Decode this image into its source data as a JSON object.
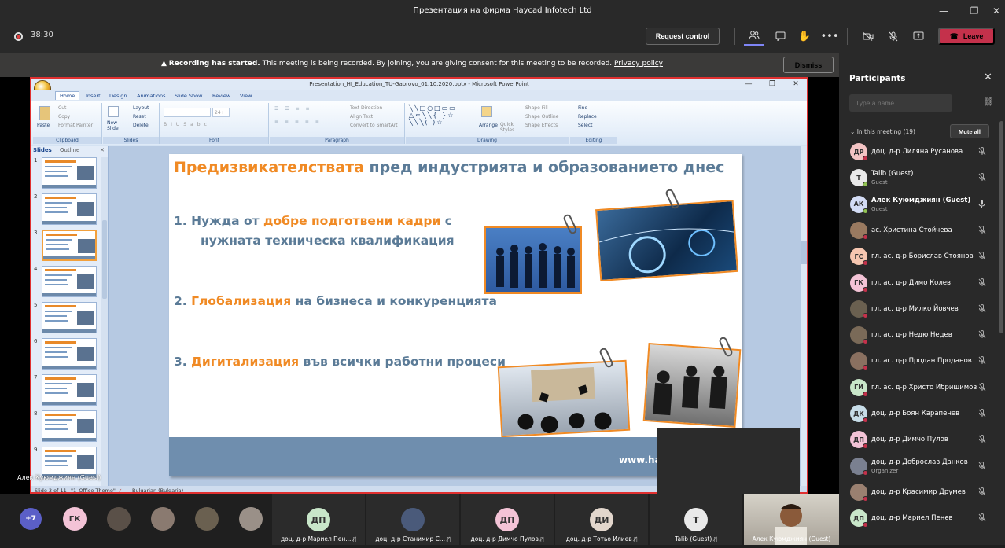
{
  "window": {
    "title": "Презентация на фирма Haycad Infotech Ltd"
  },
  "toolbar": {
    "timer": "38:30",
    "request_control": "Request control",
    "leave": "Leave"
  },
  "banner": {
    "strong": "Recording has started.",
    "message": "This meeting is being recorded. By joining, you are giving consent for this meeting to be recorded.",
    "link": "Privacy policy",
    "dismiss": "Dismiss"
  },
  "ppt": {
    "title": "Presentation_HI_Education_TU-Gabrovo_01.10.2020.pptx - Microsoft PowerPoint",
    "tabs": [
      "Home",
      "Insert",
      "Design",
      "Animations",
      "Slide Show",
      "Review",
      "View"
    ],
    "ribbon": {
      "clipboard": {
        "paste": "Paste",
        "cut": "Cut",
        "copy": "Copy",
        "format_painter": "Format Painter",
        "label": "Clipboard"
      },
      "slides": {
        "new_slide": "New Slide",
        "layout": "Layout",
        "reset": "Reset",
        "delete": "Delete",
        "label": "Slides"
      },
      "font": {
        "size": "24+",
        "label": "Font"
      },
      "paragraph": {
        "text_direction": "Text Direction",
        "align_text": "Align Text",
        "smartart": "Convert to SmartArt",
        "label": "Paragraph"
      },
      "drawing": {
        "arrange": "Arrange",
        "quick_styles": "Quick Styles",
        "shape_fill": "Shape Fill",
        "shape_outline": "Shape Outline",
        "shape_effects": "Shape Effects",
        "label": "Drawing"
      },
      "editing": {
        "find": "Find",
        "replace": "Replace",
        "select": "Select",
        "label": "Editing"
      }
    },
    "pane_tabs": {
      "slides": "Slides",
      "outline": "Outline"
    },
    "thumb_numbers": [
      "1",
      "2",
      "3",
      "4",
      "5",
      "6",
      "7",
      "8",
      "9"
    ],
    "status": {
      "slide": "Slide 3 of 11",
      "theme": "\"1_Office Theme\"",
      "lang": "Bulgarian (Bulgaria)"
    }
  },
  "slide": {
    "title_hl": "Предизвикателствата",
    "title_rest": " пред индустрията и образованието днес",
    "item1_a": "1.   Нужда от ",
    "item1_hl": "добре подготвени кадри",
    "item1_b": " с",
    "item1_line2": "нужната техническа квалификация",
    "item2_a": "2. ",
    "item2_hl": "Глобализация",
    "item2_b": " на бизнеса и конкуренцията",
    "item3_a": "3. ",
    "item3_hl": "Дигитализация",
    "item3_b": " във всички работни процеси",
    "url": "www.hay"
  },
  "presenter_label": "Алек Куюмджиян (Guest)",
  "bottom": {
    "more": "+7",
    "gk": "ГК",
    "tiles": [
      {
        "initials": "ДП",
        "name": "доц. д-р Мариел Пен..."
      },
      {
        "initials": "",
        "name": "доц. д-р Станимир С..."
      },
      {
        "initials": "ДП",
        "name": "доц. д-р Димчо Пулов"
      },
      {
        "initials": "ДИ",
        "name": "доц. д-р Тотьо Илиев"
      },
      {
        "initials": "Т",
        "name": "Talib (Guest)"
      },
      {
        "initials": "",
        "name": "Алек Куюмджиян (Guest)"
      }
    ]
  },
  "panel": {
    "title": "Participants",
    "search_placeholder": "Type a name",
    "in_meeting": "In this meeting (19)",
    "mute_all": "Mute all",
    "people": [
      {
        "initials": "ДР",
        "name": "доц. д-р Лиляна Русанова",
        "sub": "",
        "color": "#f3c3c3",
        "bold": false,
        "mic": "off"
      },
      {
        "initials": "T",
        "name": "Talib (Guest)",
        "sub": "Guest",
        "color": "#e9e9e9",
        "bold": false,
        "mic": "off"
      },
      {
        "initials": "АК",
        "name": "Алек Куюмджиян (Guest)",
        "sub": "Guest",
        "color": "#d3dcf5",
        "bold": true,
        "mic": "on"
      },
      {
        "initials": "",
        "name": "ас. Христина Стойчева",
        "sub": "",
        "color": "#9a7a60",
        "bold": false,
        "mic": "off"
      },
      {
        "initials": "ГС",
        "name": "гл. ас. д-р Борислав Стоянов",
        "sub": "",
        "color": "#f6c6b0",
        "bold": false,
        "mic": "off"
      },
      {
        "initials": "ГК",
        "name": "гл. ас. д-р Димо Колев",
        "sub": "",
        "color": "#f3c3d6",
        "bold": false,
        "mic": "off"
      },
      {
        "initials": "",
        "name": "гл. ас. д-р Милко Йовчев",
        "sub": "",
        "color": "#6a6050",
        "bold": false,
        "mic": "off"
      },
      {
        "initials": "",
        "name": "гл. ас. д-р Недю Недев",
        "sub": "",
        "color": "#7a6a58",
        "bold": false,
        "mic": "off"
      },
      {
        "initials": "",
        "name": "гл. ас. д-р Продан Проданов",
        "sub": "",
        "color": "#8a7060",
        "bold": false,
        "mic": "off"
      },
      {
        "initials": "ГИ",
        "name": "гл. ас. д-р Христо Ибришимов",
        "sub": "",
        "color": "#c8e6c9",
        "bold": false,
        "mic": "off"
      },
      {
        "initials": "ДК",
        "name": "доц. д-р Боян Карапенев",
        "sub": "",
        "color": "#c7dde8",
        "bold": false,
        "mic": "off"
      },
      {
        "initials": "ДП",
        "name": "доц. д-р Димчо Пулов",
        "sub": "",
        "color": "#f3c3d6",
        "bold": false,
        "mic": "off"
      },
      {
        "initials": "",
        "name": "доц. д-р Доброслав Данков",
        "sub": "Organizer",
        "color": "#7a8090",
        "bold": false,
        "mic": "off"
      },
      {
        "initials": "",
        "name": "доц. д-р Красимир Друмев",
        "sub": "",
        "color": "#9a8070",
        "bold": false,
        "mic": "off"
      },
      {
        "initials": "ДП",
        "name": "доц. д-р Мариел Пенев",
        "sub": "",
        "color": "#c8e6c9",
        "bold": false,
        "mic": "off"
      }
    ]
  }
}
